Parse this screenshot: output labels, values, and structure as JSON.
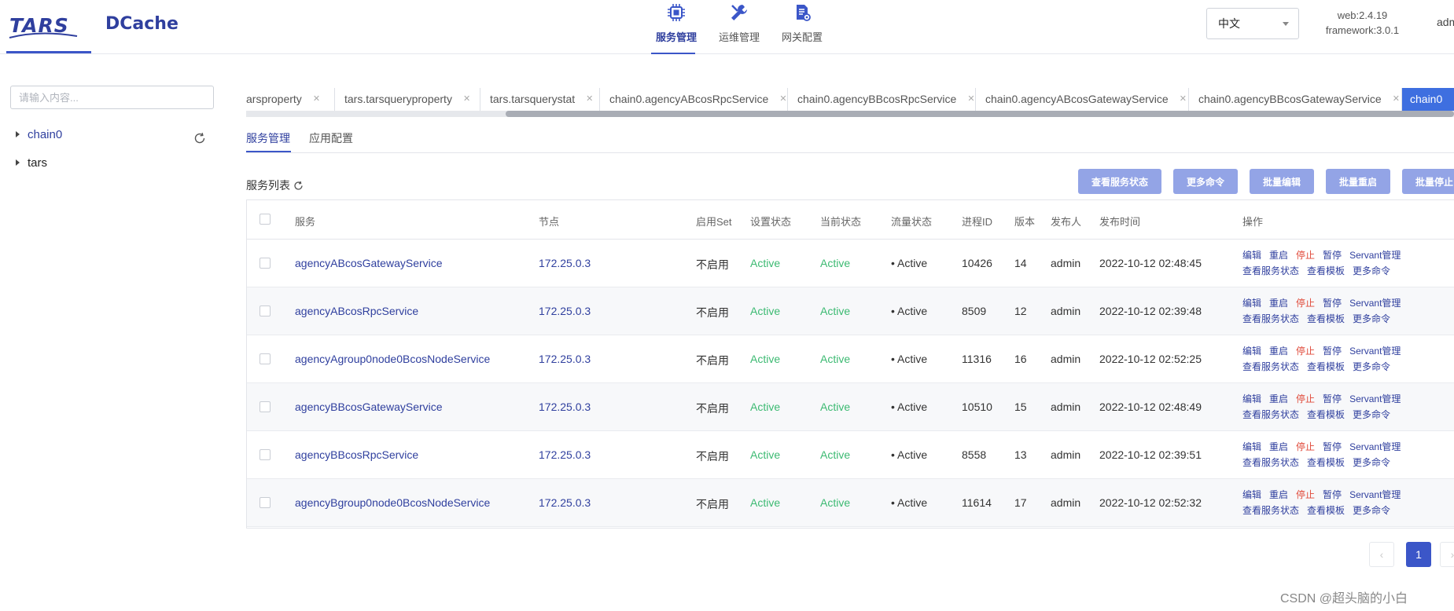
{
  "header": {
    "logo_tars": "TARS",
    "logo_dcache": "DCache",
    "nav": [
      {
        "label": "服务管理",
        "icon": "server-chip-icon",
        "active": true
      },
      {
        "label": "运维管理",
        "icon": "wrench-icon",
        "active": false
      },
      {
        "label": "网关配置",
        "icon": "gateway-doc-icon",
        "active": false
      }
    ],
    "language": "中文",
    "version_web": "web:2.4.19",
    "version_framework": "framework:3.0.1",
    "user": "adm"
  },
  "sidebar": {
    "search_placeholder": "请输入内容...",
    "tree": [
      {
        "label": "chain0",
        "selected": true
      },
      {
        "label": "tars",
        "selected": false
      }
    ]
  },
  "tabs": [
    {
      "label": "arsproperty"
    },
    {
      "label": "tars.tarsqueryproperty"
    },
    {
      "label": "tars.tarsquerystat"
    },
    {
      "label": "chain0.agencyABcosRpcService"
    },
    {
      "label": "chain0.agencyBBcosRpcService"
    },
    {
      "label": "chain0.agencyABcosGatewayService"
    },
    {
      "label": "chain0.agencyBBcosGatewayService"
    },
    {
      "label": "chain0",
      "active": true
    }
  ],
  "subtabs": [
    "服务管理",
    "应用配置"
  ],
  "toolbar": {
    "list_title": "服务列表",
    "buttons": [
      "查看服务状态",
      "更多命令",
      "批量编辑",
      "批量重启",
      "批量停止"
    ]
  },
  "table": {
    "headers": {
      "service": "服务",
      "node": "节点",
      "set": "启用Set",
      "setting_state": "设置状态",
      "current_state": "当前状态",
      "flow_state": "流量状态",
      "pid": "进程ID",
      "version": "版本",
      "publisher": "发布人",
      "publish_time": "发布时间",
      "ops": "操作"
    },
    "ops_labels": [
      "编辑",
      "重启",
      "停止",
      "暂停",
      "Servant管理",
      "查看服务状态",
      "查看模板",
      "更多命令"
    ],
    "rows": [
      {
        "service": "agencyABcosGatewayService",
        "node": "172.25.0.3",
        "set": "不启用",
        "setting_state": "Active",
        "current_state": "Active",
        "flow_state": "• Active",
        "pid": "10426",
        "version": "14",
        "publisher": "admin",
        "publish_time": "2022-10-12 02:48:45"
      },
      {
        "service": "agencyABcosRpcService",
        "node": "172.25.0.3",
        "set": "不启用",
        "setting_state": "Active",
        "current_state": "Active",
        "flow_state": "• Active",
        "pid": "8509",
        "version": "12",
        "publisher": "admin",
        "publish_time": "2022-10-12 02:39:48"
      },
      {
        "service": "agencyAgroup0node0BcosNodeService",
        "node": "172.25.0.3",
        "set": "不启用",
        "setting_state": "Active",
        "current_state": "Active",
        "flow_state": "• Active",
        "pid": "11316",
        "version": "16",
        "publisher": "admin",
        "publish_time": "2022-10-12 02:52:25"
      },
      {
        "service": "agencyBBcosGatewayService",
        "node": "172.25.0.3",
        "set": "不启用",
        "setting_state": "Active",
        "current_state": "Active",
        "flow_state": "• Active",
        "pid": "10510",
        "version": "15",
        "publisher": "admin",
        "publish_time": "2022-10-12 02:48:49"
      },
      {
        "service": "agencyBBcosRpcService",
        "node": "172.25.0.3",
        "set": "不启用",
        "setting_state": "Active",
        "current_state": "Active",
        "flow_state": "• Active",
        "pid": "8558",
        "version": "13",
        "publisher": "admin",
        "publish_time": "2022-10-12 02:39:51"
      },
      {
        "service": "agencyBgroup0node0BcosNodeService",
        "node": "172.25.0.3",
        "set": "不启用",
        "setting_state": "Active",
        "current_state": "Active",
        "flow_state": "• Active",
        "pid": "11614",
        "version": "17",
        "publisher": "admin",
        "publish_time": "2022-10-12 02:52:32"
      }
    ]
  },
  "pagination": {
    "current": "1",
    "prev": "‹",
    "next": "›"
  },
  "watermark": "CSDN @超头脑的小白",
  "colors": {
    "primary": "#3b56c8",
    "active_tab": "#3e6fe0",
    "button": "#93a4e6",
    "status_green": "#3cba72",
    "danger": "#e04a3a"
  }
}
